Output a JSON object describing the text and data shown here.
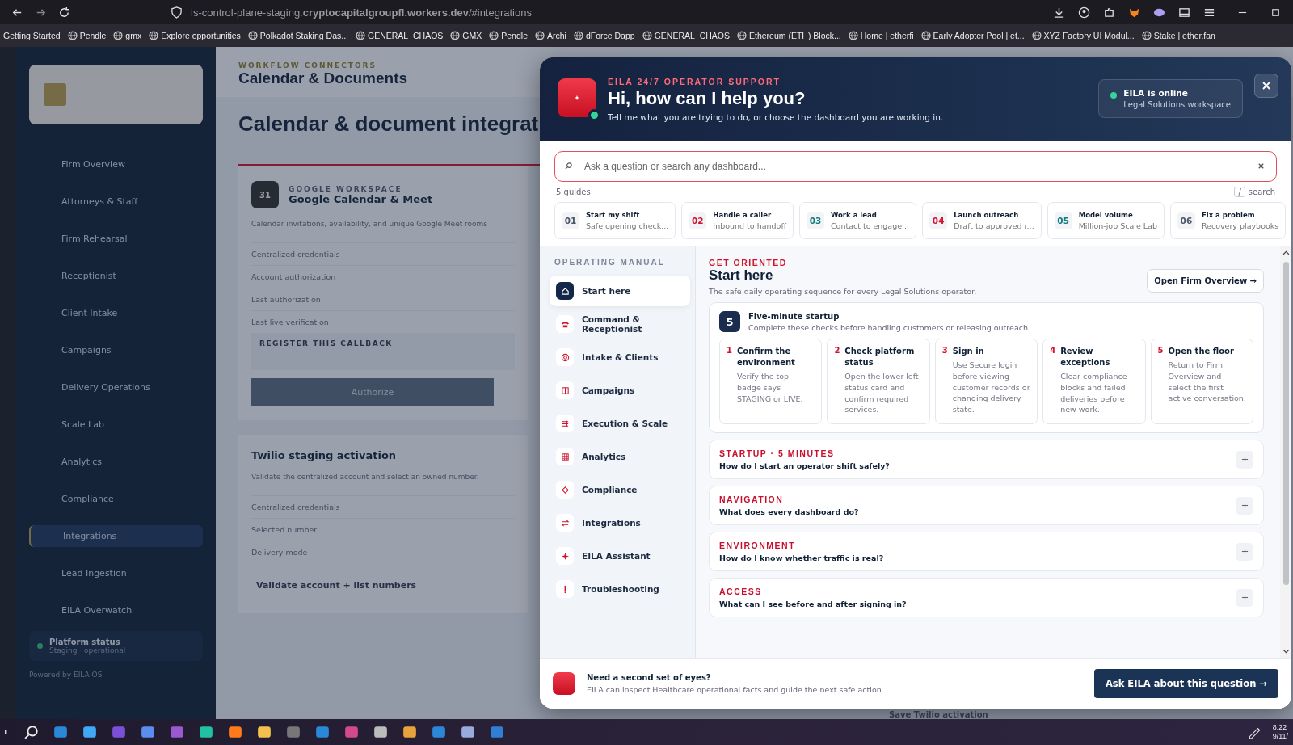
{
  "browser": {
    "url": "ls-control-plane-staging.**cryptocapitalgroupfl.workers.dev**/#integrations",
    "bookmarks": [
      {
        "label": "Getting Started",
        "kind": "text"
      },
      {
        "label": "Pendle",
        "kind": "site"
      },
      {
        "label": "gmx",
        "kind": "site"
      },
      {
        "label": "Explore opportunities",
        "kind": "site"
      },
      {
        "label": "Polkadot Staking Das...",
        "kind": "site"
      },
      {
        "label": "GENERAL_CHAOS",
        "kind": "site"
      },
      {
        "label": "GMX",
        "kind": "site"
      },
      {
        "label": "Pendle",
        "kind": "site"
      },
      {
        "label": "Archi",
        "kind": "site"
      },
      {
        "label": "dForce Dapp",
        "kind": "site"
      },
      {
        "label": "GENERAL_CHAOS",
        "kind": "site"
      },
      {
        "label": "Ethereum (ETH) Block...",
        "kind": "site"
      },
      {
        "label": "Home | etherfi",
        "kind": "site"
      },
      {
        "label": "Early Adopter Pool | et...",
        "kind": "site"
      },
      {
        "label": "XYZ Factory UI Modul...",
        "kind": "site"
      },
      {
        "label": "Stake | ether.fan",
        "kind": "site"
      }
    ]
  },
  "app": {
    "sidebar": {
      "items": [
        {
          "label": "Firm Overview",
          "selected": false
        },
        {
          "label": "Attorneys & Staff",
          "selected": false
        },
        {
          "label": "Firm Rehearsal",
          "selected": false
        },
        {
          "label": "Receptionist",
          "selected": false
        },
        {
          "label": "Client Intake",
          "selected": false
        },
        {
          "label": "Campaigns",
          "selected": false
        },
        {
          "label": "Delivery Operations",
          "selected": false
        },
        {
          "label": "Scale Lab",
          "selected": false
        },
        {
          "label": "Analytics",
          "selected": false
        },
        {
          "label": "Compliance",
          "selected": false
        },
        {
          "label": "Integrations",
          "selected": true
        },
        {
          "label": "Lead Ingestion",
          "selected": false
        },
        {
          "label": "EILA Overwatch",
          "selected": false
        }
      ],
      "status": {
        "title": "Platform status",
        "subtitle": "Staging · operational"
      },
      "footer": "Powered by EILA OS"
    },
    "header": {
      "eyebrow": "WORKFLOW CONNECTORS",
      "title": "Calendar & Documents"
    },
    "page": {
      "title": "Calendar & document integrat"
    },
    "cards": [
      {
        "eyebrow": "GOOGLE WORKSPACE",
        "title": "Google Calendar & Meet",
        "badge": "31",
        "description": "Calendar invitations, availability, and unique Google Meet rooms",
        "rows": [
          "Centralized credentials",
          "Account authorization",
          "Last authorization",
          "Last live verification"
        ],
        "callback": "REGISTER THIS CALLBACK",
        "button": "Authorize"
      },
      {
        "title": "Twilio staging activation",
        "description": "Validate the centralized account and select an owned number.",
        "rows": [
          "Centralized credentials",
          "Selected number",
          "Delivery mode"
        ],
        "button": "Validate account + list numbers"
      }
    ],
    "save_button": "Save Twilio activation"
  },
  "assistant": {
    "eyebrow": "EILA 24/7 OPERATOR SUPPORT",
    "title": "Hi, how can I help you?",
    "subtitle": "Tell me what you are trying to do, or choose the dashboard you are working in.",
    "status": {
      "title": "EILA is online",
      "subtitle": "Legal Solutions workspace",
      "online": true
    },
    "search": {
      "placeholder": "Ask a question or search any dashboard..."
    },
    "guide_count": "5 guides",
    "shortcut": {
      "key": "/",
      "label": "search"
    },
    "guides": [
      {
        "number": "01",
        "title": "Start my shift",
        "subtitle": "Safe opening check...",
        "color": "#4b5568"
      },
      {
        "number": "02",
        "title": "Handle a caller",
        "subtitle": "Inbound to handoff",
        "color": "#d0142c"
      },
      {
        "number": "03",
        "title": "Work a lead",
        "subtitle": "Contact to engage...",
        "color": "#0f7c7c"
      },
      {
        "number": "04",
        "title": "Launch outreach",
        "subtitle": "Draft to approved r...",
        "color": "#d0142c"
      },
      {
        "number": "05",
        "title": "Model volume",
        "subtitle": "Million-job Scale Lab",
        "color": "#0f7c7c"
      },
      {
        "number": "06",
        "title": "Fix a problem",
        "subtitle": "Recovery playbooks",
        "color": "#4b5568"
      }
    ],
    "manual": {
      "heading": "OPERATING MANUAL",
      "items": [
        {
          "label": "Start here",
          "kind": "home",
          "selected": true
        },
        {
          "label": "Command & Receptionist",
          "kind": "phone",
          "selected": false
        },
        {
          "label": "Intake & Clients",
          "kind": "target",
          "selected": false
        },
        {
          "label": "Campaigns",
          "kind": "columns",
          "selected": false
        },
        {
          "label": "Execution & Scale",
          "kind": "list",
          "selected": false
        },
        {
          "label": "Analytics",
          "kind": "grid",
          "selected": false
        },
        {
          "label": "Compliance",
          "kind": "diamond",
          "selected": false
        },
        {
          "label": "Integrations",
          "kind": "swap",
          "selected": false
        },
        {
          "label": "EILA Assistant",
          "kind": "sparkle",
          "selected": false
        },
        {
          "label": "Troubleshooting",
          "kind": "alert",
          "selected": false
        }
      ]
    },
    "section": {
      "eyebrow": "GET ORIENTED",
      "title": "Start here",
      "subtitle": "The safe daily operating sequence for every Legal Solutions operator.",
      "action": "Open Firm Overview →",
      "startup": {
        "badge": "5",
        "title": "Five-minute startup",
        "subtitle": "Complete these checks before handling customers or releasing outreach.",
        "steps": [
          {
            "number": "1",
            "title": "Confirm the environment",
            "text": "Verify the top badge says STAGING or LIVE."
          },
          {
            "number": "2",
            "title": "Check platform status",
            "text": "Open the lower-left status card and confirm required services."
          },
          {
            "number": "3",
            "title": "Sign in",
            "text": "Use Secure login before viewing customer records or changing delivery state."
          },
          {
            "number": "4",
            "title": "Review exceptions",
            "text": "Clear compliance blocks and failed deliveries before new work."
          },
          {
            "number": "5",
            "title": "Open the floor",
            "text": "Return to Firm Overview and select the first active conversation."
          }
        ]
      }
    },
    "faq": [
      {
        "eyebrow": "STARTUP · 5 MINUTES",
        "question": "How do I start an operator shift safely?",
        "expanded": false
      },
      {
        "eyebrow": "NAVIGATION",
        "question": "What does every dashboard do?",
        "expanded": false
      },
      {
        "eyebrow": "ENVIRONMENT",
        "question": "How do I know whether traffic is real?",
        "expanded": false
      },
      {
        "eyebrow": "ACCESS",
        "question": "What can I see before and after signing in?",
        "expanded": false
      }
    ],
    "footer": {
      "title": "Need a second set of eyes?",
      "text": "EILA can inspect Healthcare operational facts and guide the next safe action.",
      "button": "Ask EILA about this question →"
    }
  },
  "taskbar": {
    "time": "8:22",
    "date": "9/11/"
  }
}
